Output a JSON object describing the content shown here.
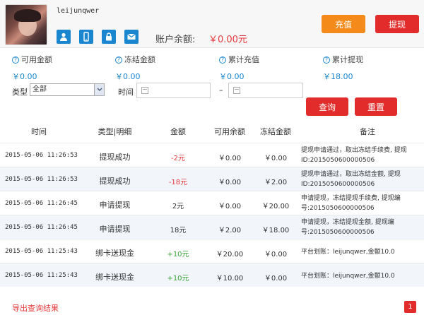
{
  "header": {
    "username": "leijunqwer",
    "balance_label": "账户余额:",
    "balance_value": "￥0.00元",
    "recharge_label": "充值",
    "withdraw_label": "提现",
    "icons": [
      "user-icon",
      "phone-icon",
      "lock-icon",
      "mail-icon"
    ],
    "icon_color": "#1a86d0"
  },
  "stats": [
    {
      "label": "可用金额",
      "value": "￥0.00"
    },
    {
      "label": "冻结金额",
      "value": "￥0.00"
    },
    {
      "label": "累计充值",
      "value": "￥0.00"
    },
    {
      "label": "累计提现",
      "value": "￥18.00"
    }
  ],
  "filter": {
    "type_label": "类型",
    "type_selected": "全部",
    "time_label": "时间",
    "dash": "–",
    "query_label": "查询",
    "reset_label": "重置"
  },
  "table": {
    "headers": [
      "时间",
      "类型|明细",
      "金额",
      "可用余额",
      "冻结金额",
      "备注"
    ],
    "rows": [
      {
        "time": "2015-05-06 11:26:53",
        "type": "提现成功",
        "amount": "-2元",
        "amount_kind": "neg",
        "available": "￥0.00",
        "frozen": "￥0.00",
        "note": "提现申请通过，取出冻结手续费, 提现ID:2015050600000506"
      },
      {
        "time": "2015-05-06 11:26:53",
        "type": "提现成功",
        "amount": "-18元",
        "amount_kind": "neg",
        "available": "￥0.00",
        "frozen": "￥2.00",
        "note": "提现申请通过，取出冻结金额, 提现ID:2015050600000506"
      },
      {
        "time": "2015-05-06 11:26:45",
        "type": "申请提现",
        "amount": "2元",
        "amount_kind": "plain",
        "available": "￥0.00",
        "frozen": "￥20.00",
        "note": "申请提现，冻结提现手续费, 提现编号:2015050600000506"
      },
      {
        "time": "2015-05-06 11:26:45",
        "type": "申请提现",
        "amount": "18元",
        "amount_kind": "plain",
        "available": "￥2.00",
        "frozen": "￥18.00",
        "note": "申请提现，冻结提现金额, 提现编号:2015050600000506"
      },
      {
        "time": "2015-05-06 11:25:43",
        "type": "绑卡送现金",
        "amount": "+10元",
        "amount_kind": "pos",
        "available": "￥20.00",
        "frozen": "￥0.00",
        "note": "平台划账：leijunqwer,金额10.0"
      },
      {
        "time": "2015-05-06 11:25:43",
        "type": "绑卡送现金",
        "amount": "+10元",
        "amount_kind": "pos",
        "available": "￥10.00",
        "frozen": "￥0.00",
        "note": "平台划账：leijunqwer,金额10.0"
      }
    ]
  },
  "footer": {
    "export_label": "导出查询结果",
    "page": "1"
  }
}
